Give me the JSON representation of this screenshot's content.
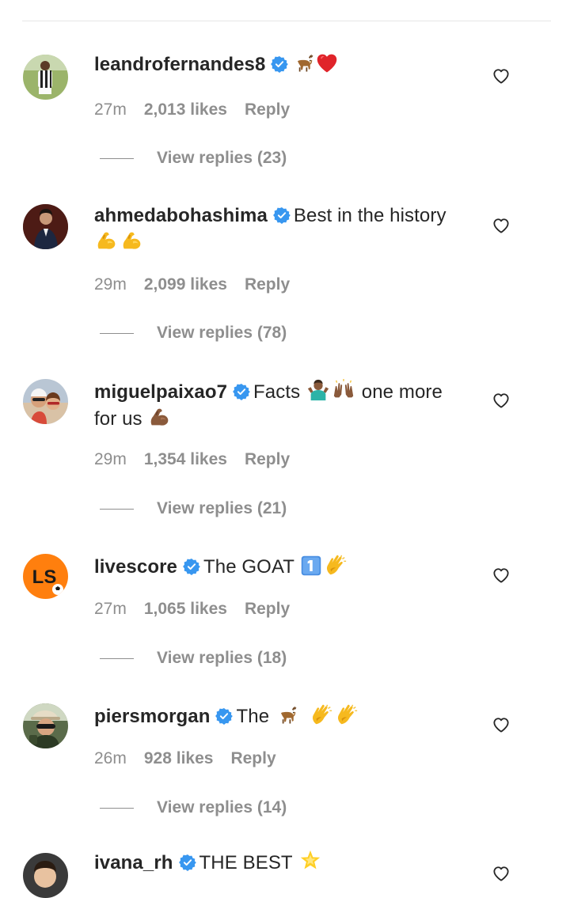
{
  "comments": [
    {
      "username": "leandrofernandes8",
      "verified": true,
      "text": "",
      "emojis": [
        "goat-emoji",
        "red-heart-emoji"
      ],
      "time": "27m",
      "likes": "2,013 likes",
      "reply_label": "Reply",
      "view_replies": "View replies (23)"
    },
    {
      "username": "ahmedabohashima",
      "verified": true,
      "text": "Best in the history",
      "emojis": [
        "flexed-biceps-emoji",
        "flexed-biceps-emoji"
      ],
      "time": "29m",
      "likes": "2,099 likes",
      "reply_label": "Reply",
      "view_replies": "View replies (78)"
    },
    {
      "username": "miguelpaixao7",
      "verified": true,
      "text": "Facts",
      "text_after": "one more",
      "text_line2": "for us",
      "emojis": [
        "person-shrugging-emoji",
        "raising-hands-emoji",
        "flexed-biceps-emoji"
      ],
      "time": "29m",
      "likes": "1,354 likes",
      "reply_label": "Reply",
      "view_replies": "View replies (21)"
    },
    {
      "username": "livescore",
      "verified": true,
      "text": "The GOAT",
      "emojis": [
        "keycap-one-emoji",
        "clapping-hands-emoji"
      ],
      "time": "27m",
      "likes": "1,065 likes",
      "reply_label": "Reply",
      "view_replies": "View replies (18)",
      "avatar_text": "LS"
    },
    {
      "username": "piersmorgan",
      "verified": true,
      "text": "The",
      "emojis": [
        "goat-emoji",
        "clapping-hands-emoji",
        "clapping-hands-emoji"
      ],
      "time": "26m",
      "likes": "928 likes",
      "reply_label": "Reply",
      "view_replies": "View replies (14)"
    },
    {
      "username": "ivana_rh",
      "verified": true,
      "text": "THE BEST",
      "emojis": [
        "glowing-star-emoji"
      ]
    }
  ],
  "colors": {
    "text": "#262626",
    "secondary": "#8e8e8e",
    "verified_blue": "#3897f0",
    "divider": "#e6e6e6",
    "livescore_orange": "#ff7f0e"
  }
}
